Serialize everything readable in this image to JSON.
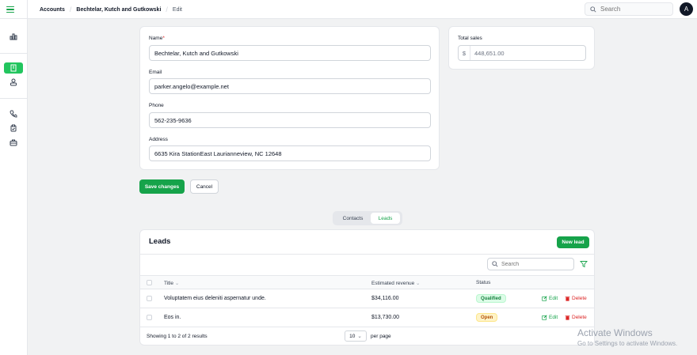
{
  "breadcrumbs": [
    "Accounts",
    "Bechtelar, Kutch and Gutkowski",
    "Edit"
  ],
  "topbar": {
    "search_placeholder": "Search",
    "avatar_initial": "A"
  },
  "form": {
    "name_label": "Name",
    "name_required_marker": "*",
    "name_value": "Bechtelar, Kutch and Gutkowski",
    "email_label": "Email",
    "email_value": "parker.angelo@example.net",
    "phone_label": "Phone",
    "phone_value": "562-235-9636",
    "address_label": "Address",
    "address_value": "6635 Kira StationEast Laurianneview, NC 12648"
  },
  "total_sales": {
    "label": "Total sales",
    "currency": "$",
    "value": "448,651.00"
  },
  "buttons": {
    "save": "Save changes",
    "cancel": "Cancel"
  },
  "tabs": [
    {
      "label": "Contacts",
      "active": false
    },
    {
      "label": "Leads",
      "active": true
    }
  ],
  "leads": {
    "title": "Leads",
    "new_button": "New lead",
    "search_placeholder": "Search",
    "columns": {
      "title": "Title",
      "revenue": "Estimated revenue",
      "status": "Status"
    },
    "rows": [
      {
        "title": "Voluptatem eius deleniti aspernatur unde.",
        "revenue": "$34,116.00",
        "status": "Qualified",
        "edit": "Edit",
        "delete": "Delete"
      },
      {
        "title": "Eos in.",
        "revenue": "$13,730.00",
        "status": "Open",
        "edit": "Edit",
        "delete": "Delete"
      }
    ],
    "footer": {
      "showing": "Showing 1 to 2 of 2 results",
      "per_page_value": "10",
      "per_page_label": "per page"
    }
  },
  "watermark": {
    "line1": "Activate Windows",
    "line2": "Go to Settings to activate Windows."
  },
  "colors": {
    "accent": "#16a34a",
    "active_nav": "#22c55e",
    "danger": "#dc2626",
    "warning": "#b45309"
  }
}
